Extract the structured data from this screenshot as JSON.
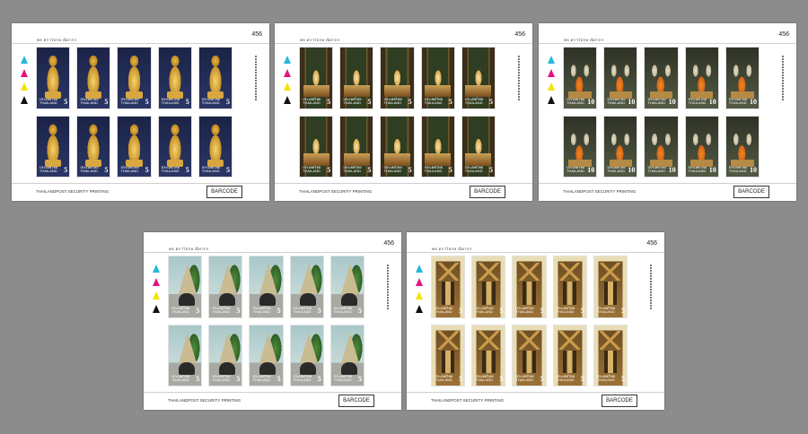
{
  "background_color": "#8c8c8c",
  "sheets": [
    {
      "id": "sheet1",
      "sheet_number": "456",
      "thai_header": "พล ตราไปรษ ณียากร",
      "printer": "THAILANDPOST SECURITY PRINTING",
      "barcode_label": "BARCODE",
      "design": "d1",
      "stamp": {
        "country_thai": "ประเทศไทย",
        "country": "THAILAND",
        "value": "5"
      }
    },
    {
      "id": "sheet2",
      "sheet_number": "456",
      "thai_header": "พล ตราไปรษ ณียากร",
      "printer": "THAILANDPOST SECURITY PRINTING",
      "barcode_label": "BARCODE",
      "design": "d2",
      "stamp": {
        "country_thai": "ประเทศไทย",
        "country": "THAILAND",
        "value": "5"
      }
    },
    {
      "id": "sheet3",
      "sheet_number": "456",
      "thai_header": "พล ตราไปรษ ณียากร",
      "printer": "THAILANDPOST SECURITY PRINTING",
      "barcode_label": "BARCODE",
      "design": "d3",
      "stamp": {
        "country_thai": "ประเทศไทย",
        "country": "THAILAND",
        "value": "10"
      }
    },
    {
      "id": "sheet4",
      "sheet_number": "456",
      "thai_header": "พล ตราไปรษ ณียากร",
      "printer": "THAILANDPOST SECURITY PRINTING",
      "barcode_label": "BARCODE",
      "design": "d4",
      "stamp": {
        "country_thai": "ประเทศไทย",
        "country": "THAILAND",
        "value": "5"
      }
    },
    {
      "id": "sheet5",
      "sheet_number": "456",
      "thai_header": "พล ตราไปรษ ณียากร",
      "printer": "THAILANDPOST SECURITY PRINTING",
      "barcode_label": "BARCODE",
      "design": "d5",
      "stamp": {
        "country_thai": "ประเทศไทย",
        "country": "THAILAND",
        "value": "5"
      }
    }
  ],
  "registration_marks": [
    "cyan-tree-icon",
    "magenta-tree-icon",
    "yellow-tree-icon",
    "black-tree-icon"
  ],
  "mark_colors": [
    "#27b7d9",
    "#e3127d",
    "#f6e200",
    "#111111"
  ]
}
